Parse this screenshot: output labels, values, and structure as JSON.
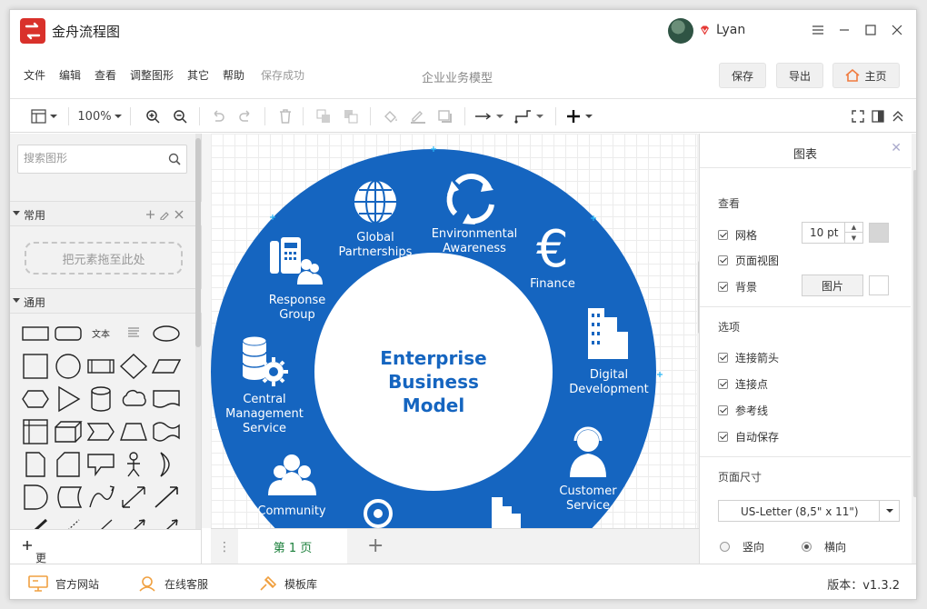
{
  "app": {
    "title": "金舟流程图",
    "username": "Lyan"
  },
  "menu": {
    "items": [
      "文件",
      "编辑",
      "查看",
      "调整图形",
      "其它",
      "帮助"
    ],
    "save_status": "保存成功",
    "doc_title": "企业业务模型",
    "save_btn": "保存",
    "export_btn": "导出",
    "home_btn": "主页"
  },
  "toolbar": {
    "zoom": "100%"
  },
  "left_panel": {
    "search_placeholder": "搜索图形",
    "section_common": "常用",
    "drop_hint": "把元素拖至此处",
    "section_general": "通用",
    "shape_text": "文本",
    "more_shapes": "更多图形..."
  },
  "diagram": {
    "center_lines": [
      "Enterprise",
      "Business",
      "Model"
    ],
    "ring_color": "#1565c0",
    "nodes": [
      {
        "lines": [
          "Global",
          "Partnerships"
        ],
        "icon": "globe-icon"
      },
      {
        "lines": [
          "Environmental",
          "Awareness"
        ],
        "icon": "recycle-icon"
      },
      {
        "lines": [
          "Finance"
        ],
        "icon": "euro-icon"
      },
      {
        "lines": [
          "Digital",
          "Development"
        ],
        "icon": "buildings-icon"
      },
      {
        "lines": [
          "Customer",
          "Service"
        ],
        "icon": "headset-icon"
      },
      {
        "lines": [
          "Community"
        ],
        "icon": "people-icon"
      },
      {
        "lines": [
          "Central",
          "Management",
          "Service"
        ],
        "icon": "database-gear-icon"
      },
      {
        "lines": [
          "Response",
          "Group"
        ],
        "icon": "phone-group-icon"
      }
    ]
  },
  "page_tabs": {
    "current": "第 1 页"
  },
  "right_panel": {
    "title": "图表",
    "view_section": "查看",
    "grid_label": "网格",
    "grid_size": "10 pt",
    "page_view_label": "页面视图",
    "background_label": "背景",
    "image_btn": "图片",
    "options_section": "选项",
    "connect_arrows": "连接箭头",
    "connect_points": "连接点",
    "guides": "参考线",
    "autosave": "自动保存",
    "page_size_section": "页面尺寸",
    "page_size_value": "US-Letter (8,5\" x 11\")",
    "portrait": "竖向",
    "landscape": "横向"
  },
  "footer": {
    "website": "官方网站",
    "support": "在线客服",
    "templates": "模板库",
    "version": "版本：v1.3.2"
  }
}
